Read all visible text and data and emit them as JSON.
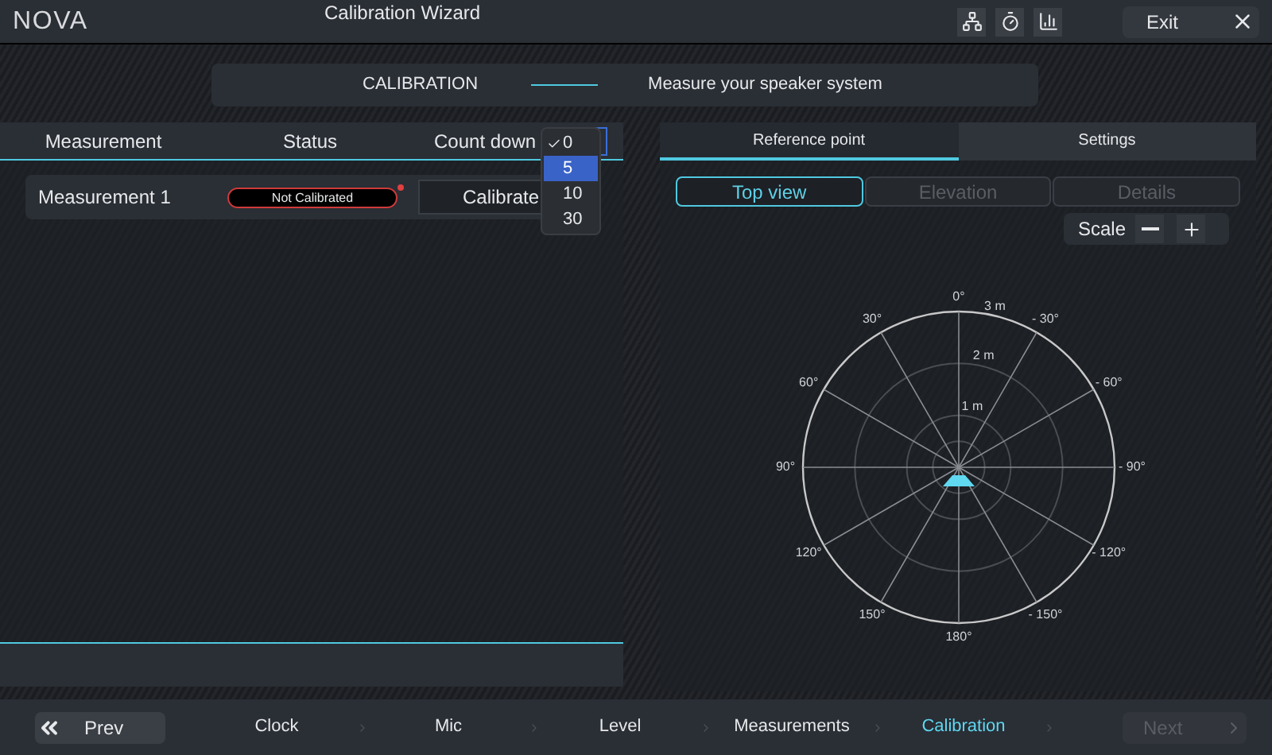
{
  "header": {
    "logo": "NOVA",
    "title": "Calibration Wizard",
    "exit_button": "Exit"
  },
  "step_banner": {
    "step": "CALIBRATION",
    "description": "Measure your speaker system"
  },
  "measurements": {
    "columns": [
      "Measurement",
      "Status",
      "Count down"
    ],
    "rows": [
      {
        "name": "Measurement 1",
        "status": "Not Calibrated",
        "calibrated": false,
        "action": "Calibrate"
      }
    ],
    "countdown_menu": [
      {
        "label": "0",
        "checked": true,
        "highlighted": false
      },
      {
        "label": "5",
        "checked": false,
        "highlighted": true
      },
      {
        "label": "10",
        "checked": false,
        "highlighted": false
      },
      {
        "label": "30",
        "checked": false,
        "highlighted": false
      }
    ]
  },
  "panel_tabs": [
    {
      "label": "Reference point",
      "selected": true
    },
    {
      "label": "Settings",
      "selected": false
    }
  ],
  "view_tabs": [
    {
      "label": "Top view",
      "selected": true,
      "disabled": false
    },
    {
      "label": "Elevation",
      "selected": false,
      "disabled": true
    },
    {
      "label": "Details",
      "selected": false,
      "disabled": true
    }
  ],
  "scale": {
    "label": "Scale"
  },
  "polar_plot": {
    "angle_labels": [
      "0°",
      "30°",
      "60°",
      "90°",
      "120°",
      "150°",
      "180°",
      "- 150°",
      "- 120°",
      "- 90°",
      "- 60°",
      "- 30°"
    ],
    "ring_labels": [
      "1 m",
      "2 m",
      "3 m"
    ]
  },
  "nav": {
    "prev": "Prev",
    "next": "Next",
    "next_disabled": true,
    "steps": [
      {
        "label": "Clock",
        "active": false
      },
      {
        "label": "Mic",
        "active": false
      },
      {
        "label": "Level",
        "active": false
      },
      {
        "label": "Measurements",
        "active": false
      },
      {
        "label": "Calibration",
        "active": true
      }
    ]
  }
}
